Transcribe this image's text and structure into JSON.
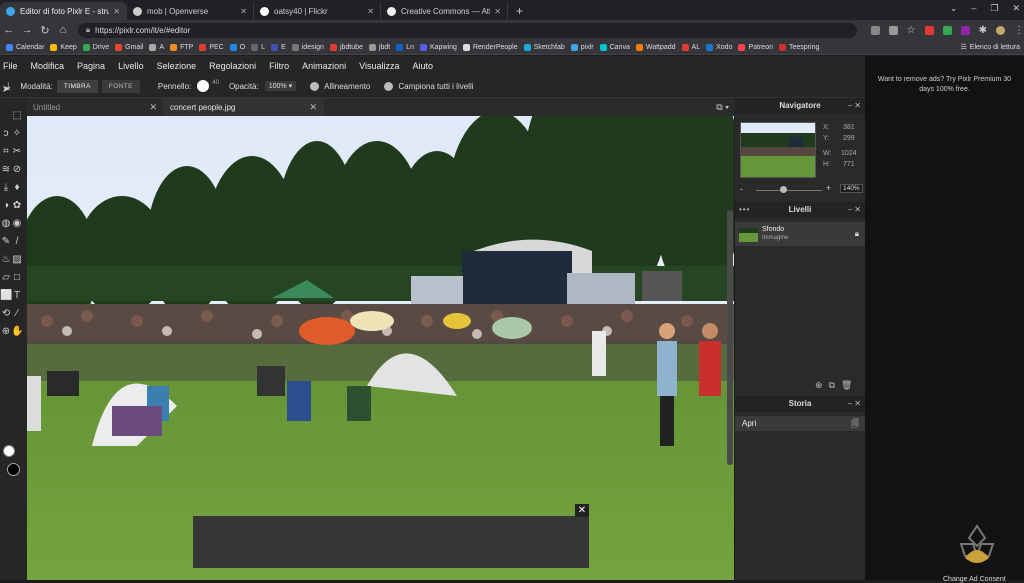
{
  "browser": {
    "tabs": [
      {
        "label": "Editor di foto Pixlr E - strumento",
        "favicon_color": "#3ba7e8",
        "active": true
      },
      {
        "label": "mob | Openverse",
        "favicon_color": "#cccccc",
        "active": false
      },
      {
        "label": "oatsy40 | Flickr",
        "favicon_color": "#ffffff",
        "active": false
      },
      {
        "label": "Creative Commons — Attribution",
        "favicon_color": "#eeeeee",
        "active": false
      }
    ],
    "new_tab": "+",
    "url": "https://pixlr.com/it/e/#editor",
    "bookmarks": [
      {
        "label": "Calendar",
        "color": "#4285f4"
      },
      {
        "label": "Keep",
        "color": "#fbbc04"
      },
      {
        "label": "Drive",
        "color": "#34a853"
      },
      {
        "label": "Gmail",
        "color": "#ea4335"
      },
      {
        "label": "A",
        "color": "#aaaaaa"
      },
      {
        "label": "FTP",
        "color": "#f28b22"
      },
      {
        "label": "PEC",
        "color": "#e53935"
      },
      {
        "label": "O",
        "color": "#1e88e5"
      },
      {
        "label": "L",
        "color": "#666666"
      },
      {
        "label": "E",
        "color": "#3f51b5"
      },
      {
        "label": "idesign",
        "color": "#777777"
      },
      {
        "label": "jbdtube",
        "color": "#e53935"
      },
      {
        "label": "jbdt",
        "color": "#999999"
      },
      {
        "label": "Ln",
        "color": "#0a66c2"
      },
      {
        "label": "Kapwing",
        "color": "#5a5af5"
      },
      {
        "label": "RenderPeople",
        "color": "#dddddd"
      },
      {
        "label": "Sketchfab",
        "color": "#1caad9"
      },
      {
        "label": "pixlr",
        "color": "#3ba7e8"
      },
      {
        "label": "Canva",
        "color": "#00c4cc"
      },
      {
        "label": "Wattpadd",
        "color": "#f57c00"
      },
      {
        "label": "AL",
        "color": "#e53935"
      },
      {
        "label": "Xodo",
        "color": "#1976d2"
      },
      {
        "label": "Patreon",
        "color": "#ff424d"
      },
      {
        "label": "Teespring",
        "color": "#d32f2f"
      }
    ],
    "reading_list": "Elenco di lettura"
  },
  "menu": [
    "File",
    "Modifica",
    "Pagina",
    "Livello",
    "Selezione",
    "Regolazioni",
    "Filtro",
    "Animazioni",
    "Visualizza",
    "Aiuto"
  ],
  "toolopts": {
    "mode_label": "Modalità:",
    "mode_a": "TIMBRA",
    "mode_b": "FONTE",
    "brush_label": "Pennello:",
    "brush_size": "40",
    "opacity_label": "Opacità:",
    "opacity_value": "100% ▾",
    "align_label": "Allineamento",
    "sample_label": "Campiona tutti i livelli"
  },
  "docs": {
    "tabs": [
      {
        "label": "Untitled",
        "active": false
      },
      {
        "label": "concert people.jpg",
        "active": true
      }
    ]
  },
  "navigator": {
    "title": "Navigatore",
    "x_label": "X:",
    "x_value": "381",
    "y_label": "Y:",
    "y_value": "299",
    "w_label": "W:",
    "w_value": "1024",
    "h_label": "H:",
    "h_value": "771",
    "zoom_value": "140%"
  },
  "layers": {
    "title": "Livelli",
    "layer_name": "Sfondo",
    "layer_type": "Immagine"
  },
  "history": {
    "title": "Storia",
    "item": "Apri"
  },
  "ad_sidebar": {
    "text": "Want to remove ads? Try Pixlr Premium 30 days 100% free.",
    "consent": "Change Ad Consent"
  }
}
